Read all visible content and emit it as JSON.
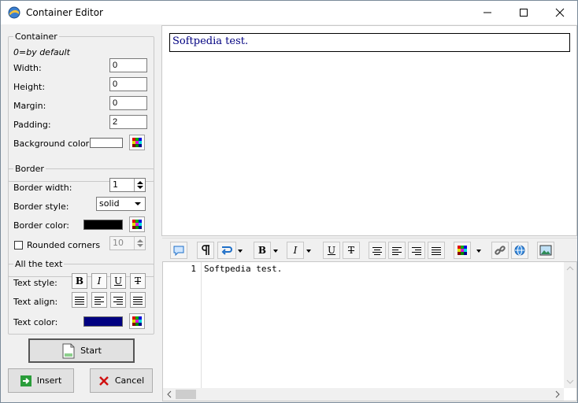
{
  "window": {
    "title": "Container Editor"
  },
  "container": {
    "legend": "Container",
    "hint": "0=by default",
    "width_label": "Width:",
    "width_value": "0",
    "height_label": "Height:",
    "height_value": "0",
    "margin_label": "Margin:",
    "margin_value": "0",
    "padding_label": "Padding:",
    "padding_value": "2",
    "bg_color_label": "Background color:",
    "bg_color": "#ffffff"
  },
  "border": {
    "legend": "Border",
    "width_label": "Border width:",
    "width_value": "1",
    "style_label": "Border style:",
    "style_value": "solid",
    "color_label": "Border color:",
    "color": "#000000",
    "rounded_label": "Rounded corners",
    "rounded_checked": false,
    "rounded_value": "10"
  },
  "text": {
    "legend": "All the text",
    "style_label": "Text style:",
    "align_label": "Text align:",
    "color_label": "Text color:",
    "color": "#000080"
  },
  "buttons": {
    "start": "Start",
    "insert": "Insert",
    "cancel": "Cancel"
  },
  "preview": {
    "text": "Softpedia test."
  },
  "editor": {
    "line_number": "1",
    "code": "Softpedia test."
  },
  "colors": {
    "insert_icon": "#2a9d3a",
    "cancel_icon": "#d01010",
    "toolbar_icon_blue": "#1e6fc8"
  }
}
